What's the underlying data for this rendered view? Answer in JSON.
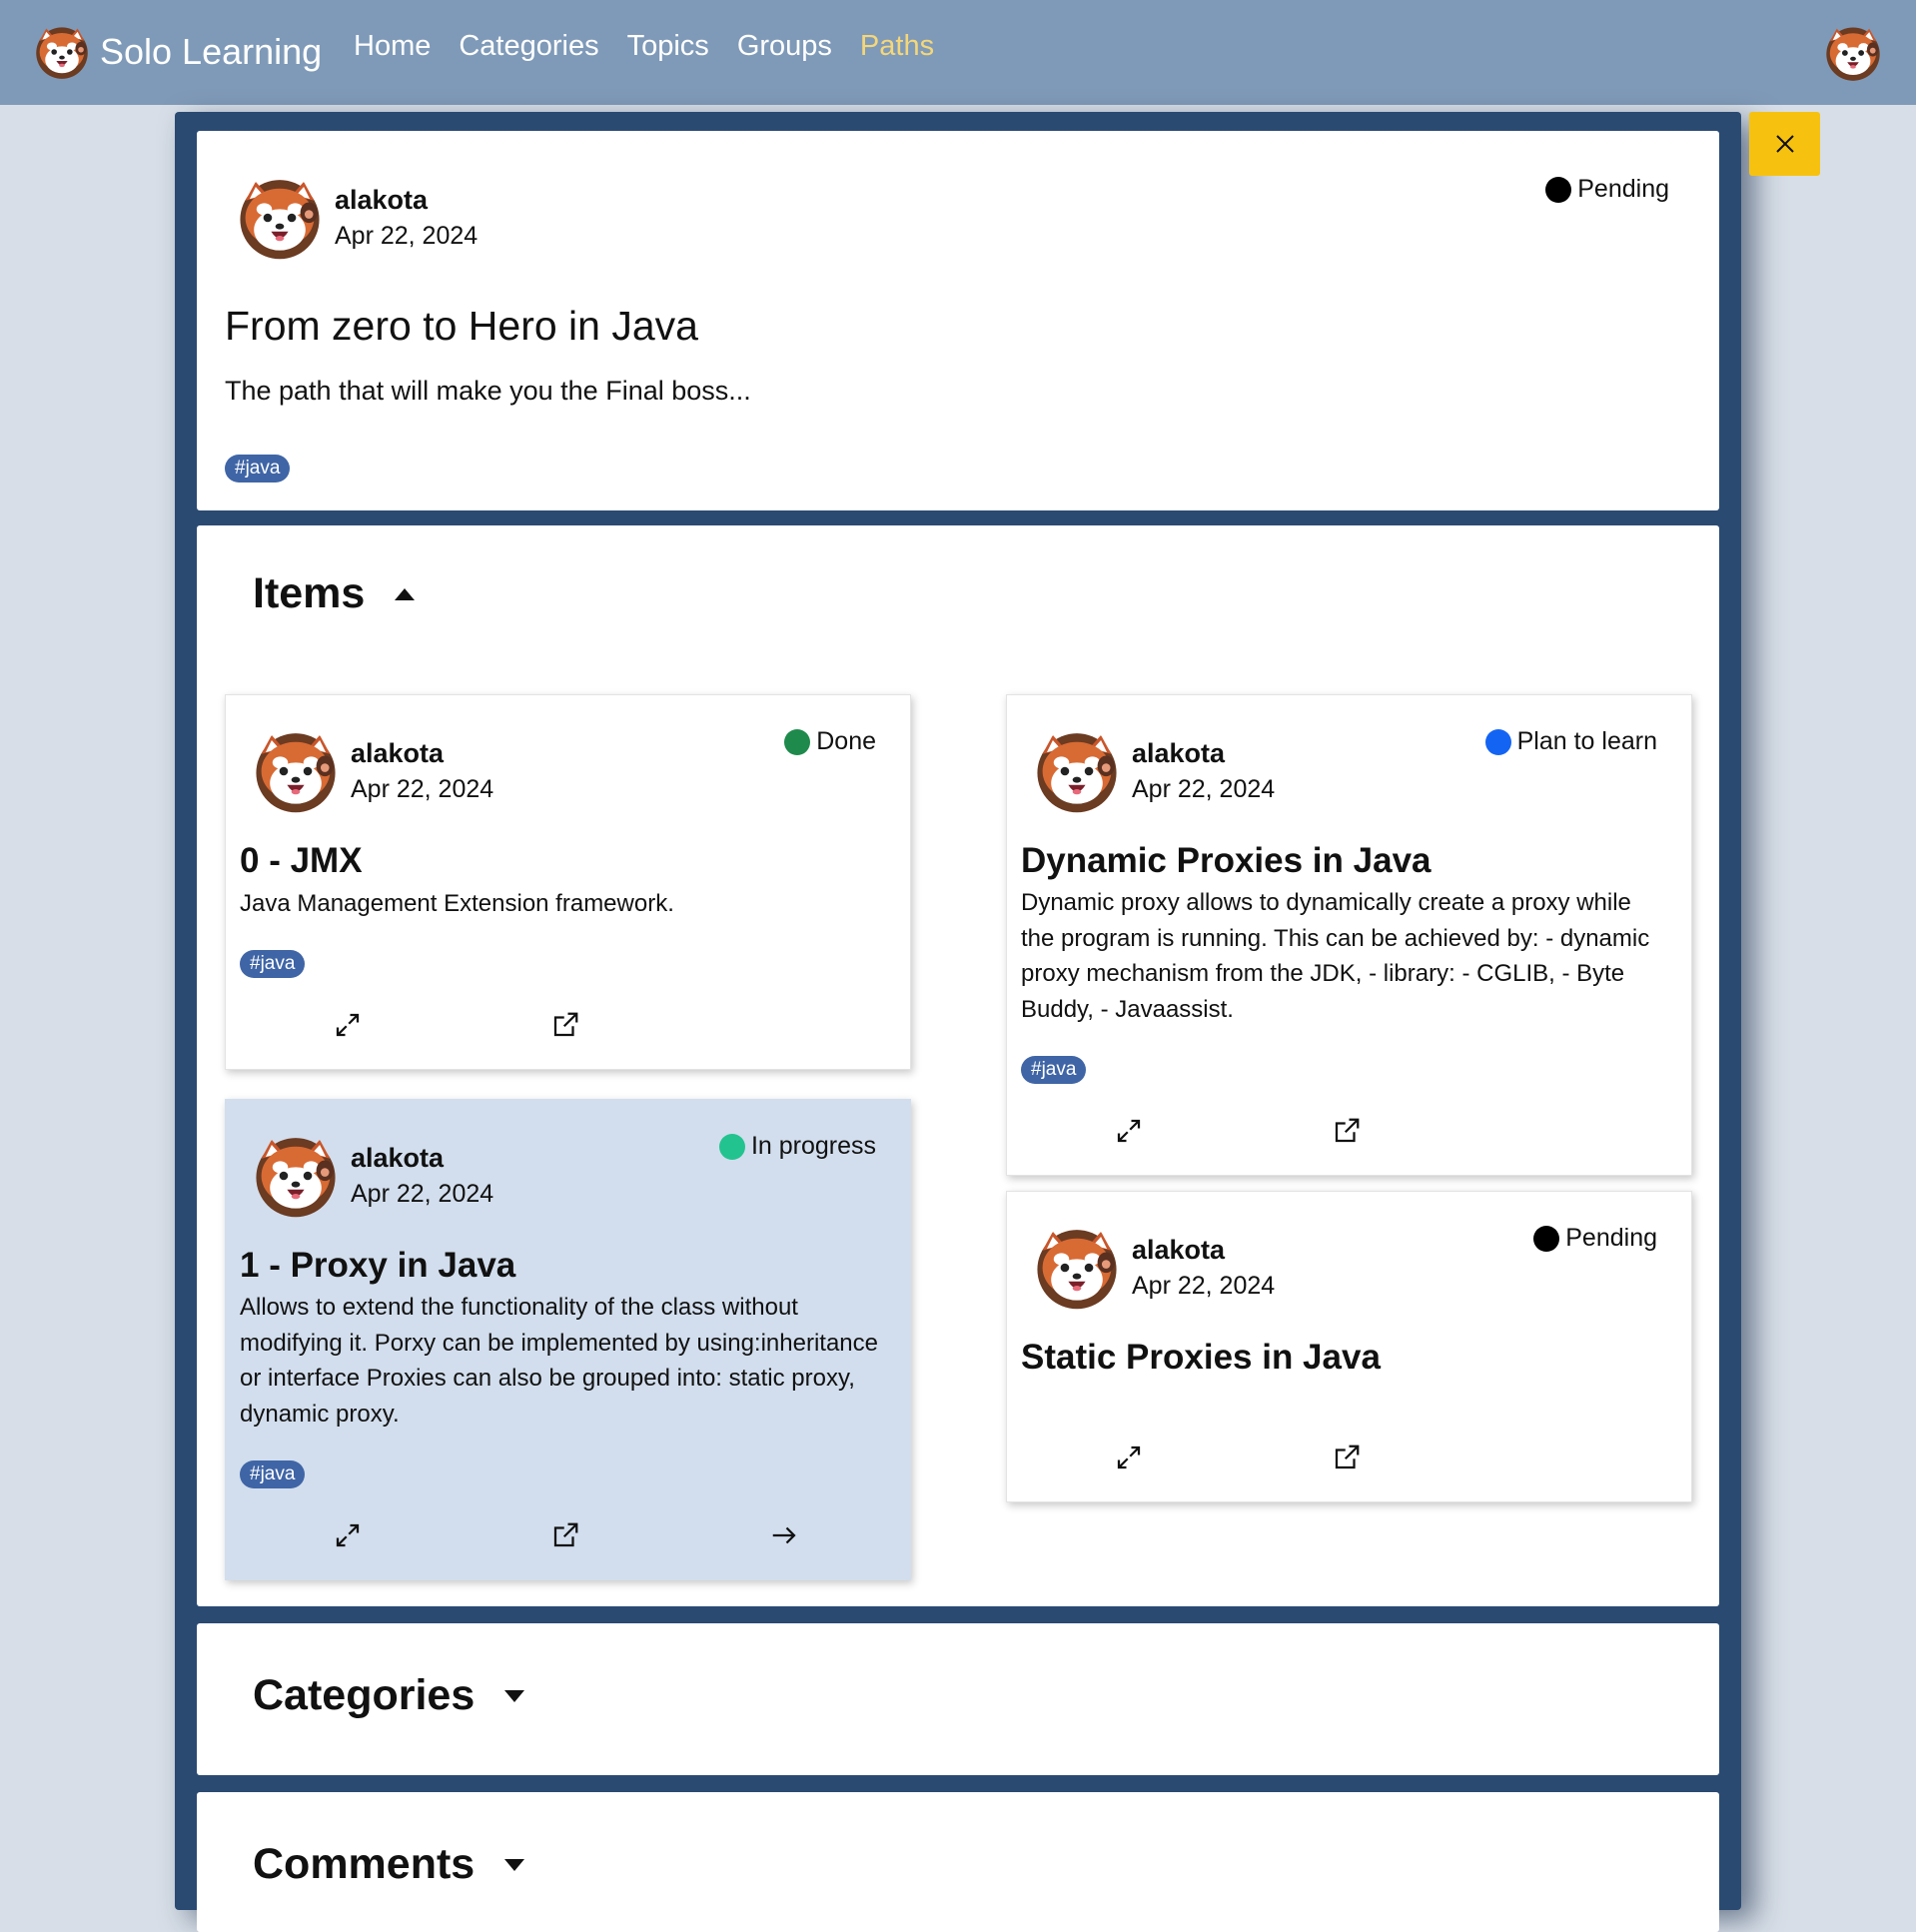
{
  "navbar": {
    "brand": "Solo Learning",
    "links": [
      "Home",
      "Categories",
      "Topics",
      "Groups",
      "Paths"
    ],
    "active": "Paths"
  },
  "path": {
    "author": "alakota",
    "date": "Apr 22, 2024",
    "status": "Pending",
    "title": "From zero to Hero in Java",
    "description": "The path that will make you the Final boss...",
    "tag": "#java"
  },
  "sections": {
    "items": "Items",
    "categories": "Categories",
    "comments": "Comments"
  },
  "items": [
    {
      "author": "alakota",
      "date": "Apr 22, 2024",
      "status": "Done",
      "status_color": "#1e8a4c",
      "title": "0 - JMX",
      "description": "Java Management Extension framework.",
      "tag": "#java"
    },
    {
      "author": "alakota",
      "date": "Apr 22, 2024",
      "status": "In progress",
      "status_color": "#22c38f",
      "title": "1 - Proxy in Java",
      "description": "Allows to extend the functionality of the class without modifying it. Porxy can be implemented by using:inheritance or interface Proxies can also be grouped into: static proxy, dynamic proxy.",
      "tag": "#java"
    },
    {
      "author": "alakota",
      "date": "Apr 22, 2024",
      "status": "Plan to learn",
      "status_color": "#1464f4",
      "title": "Dynamic Proxies in Java",
      "description": "Dynamic proxy allows to dynamically create a proxy while the program is running. This can be achieved by: - dynamic proxy mechanism from the JDK, - library: - CGLIB, - Byte Buddy, - Javaassist.",
      "tag": "#java"
    },
    {
      "author": "alakota",
      "date": "Apr 22, 2024",
      "status": "Pending",
      "status_color": "#000000",
      "title": "Static Proxies in Java",
      "description": "",
      "tag": ""
    }
  ],
  "colors": {
    "navbar": "#7f9ab8",
    "modal": "#2a4a72",
    "tag": "#3f65a6",
    "close_button": "#f6c20f",
    "highlight": "#d2deed"
  }
}
